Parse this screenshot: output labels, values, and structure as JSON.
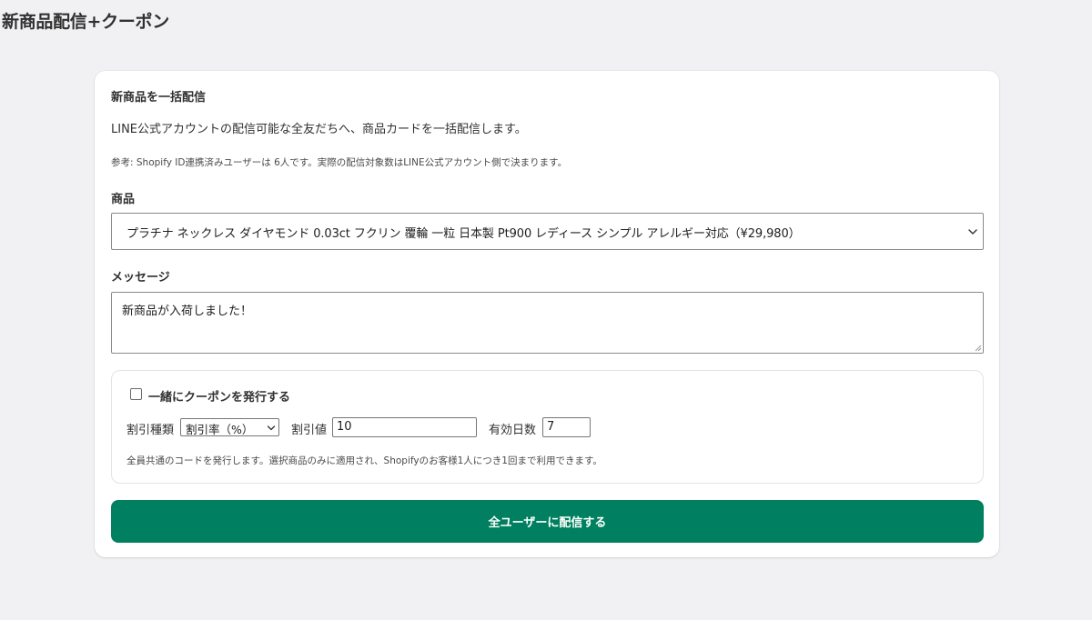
{
  "page": {
    "title": "新商品配信+クーポン"
  },
  "card": {
    "title": "新商品を一括配信",
    "description": "LINE公式アカウントの配信可能な全友だちへ、商品カードを一括配信します。",
    "note": "参考: Shopify ID連携済みユーザーは 6人です。実際の配信対象数はLINE公式アカウント側で決まります。"
  },
  "product_field": {
    "label": "商品",
    "selected": "プラチナ ネックレス ダイヤモンド 0.03ct フクリン 覆輪 一粒 日本製 Pt900 レディース シンプル アレルギー対応（¥29,980）",
    "icon": "chevron-down-icon"
  },
  "message_field": {
    "label": "メッセージ",
    "value": "新商品が入荷しました！"
  },
  "coupon": {
    "checkbox_label": "一緒にクーポンを発行する",
    "checked": false,
    "discount_type_label": "割引種類",
    "discount_type_selected": "割引率（%）",
    "discount_value_label": "割引値",
    "discount_value": "10",
    "valid_days_label": "有効日数",
    "valid_days": "7",
    "help_text": "全員共通のコードを発行します。選択商品のみに適用され、Shopifyのお客様1人につき1回まで利用できます。"
  },
  "submit": {
    "label": "全ユーザーに配信する"
  },
  "colors": {
    "background": "#f1f1f3",
    "card": "#ffffff",
    "primary_button": "#008060",
    "text": "#303030"
  }
}
